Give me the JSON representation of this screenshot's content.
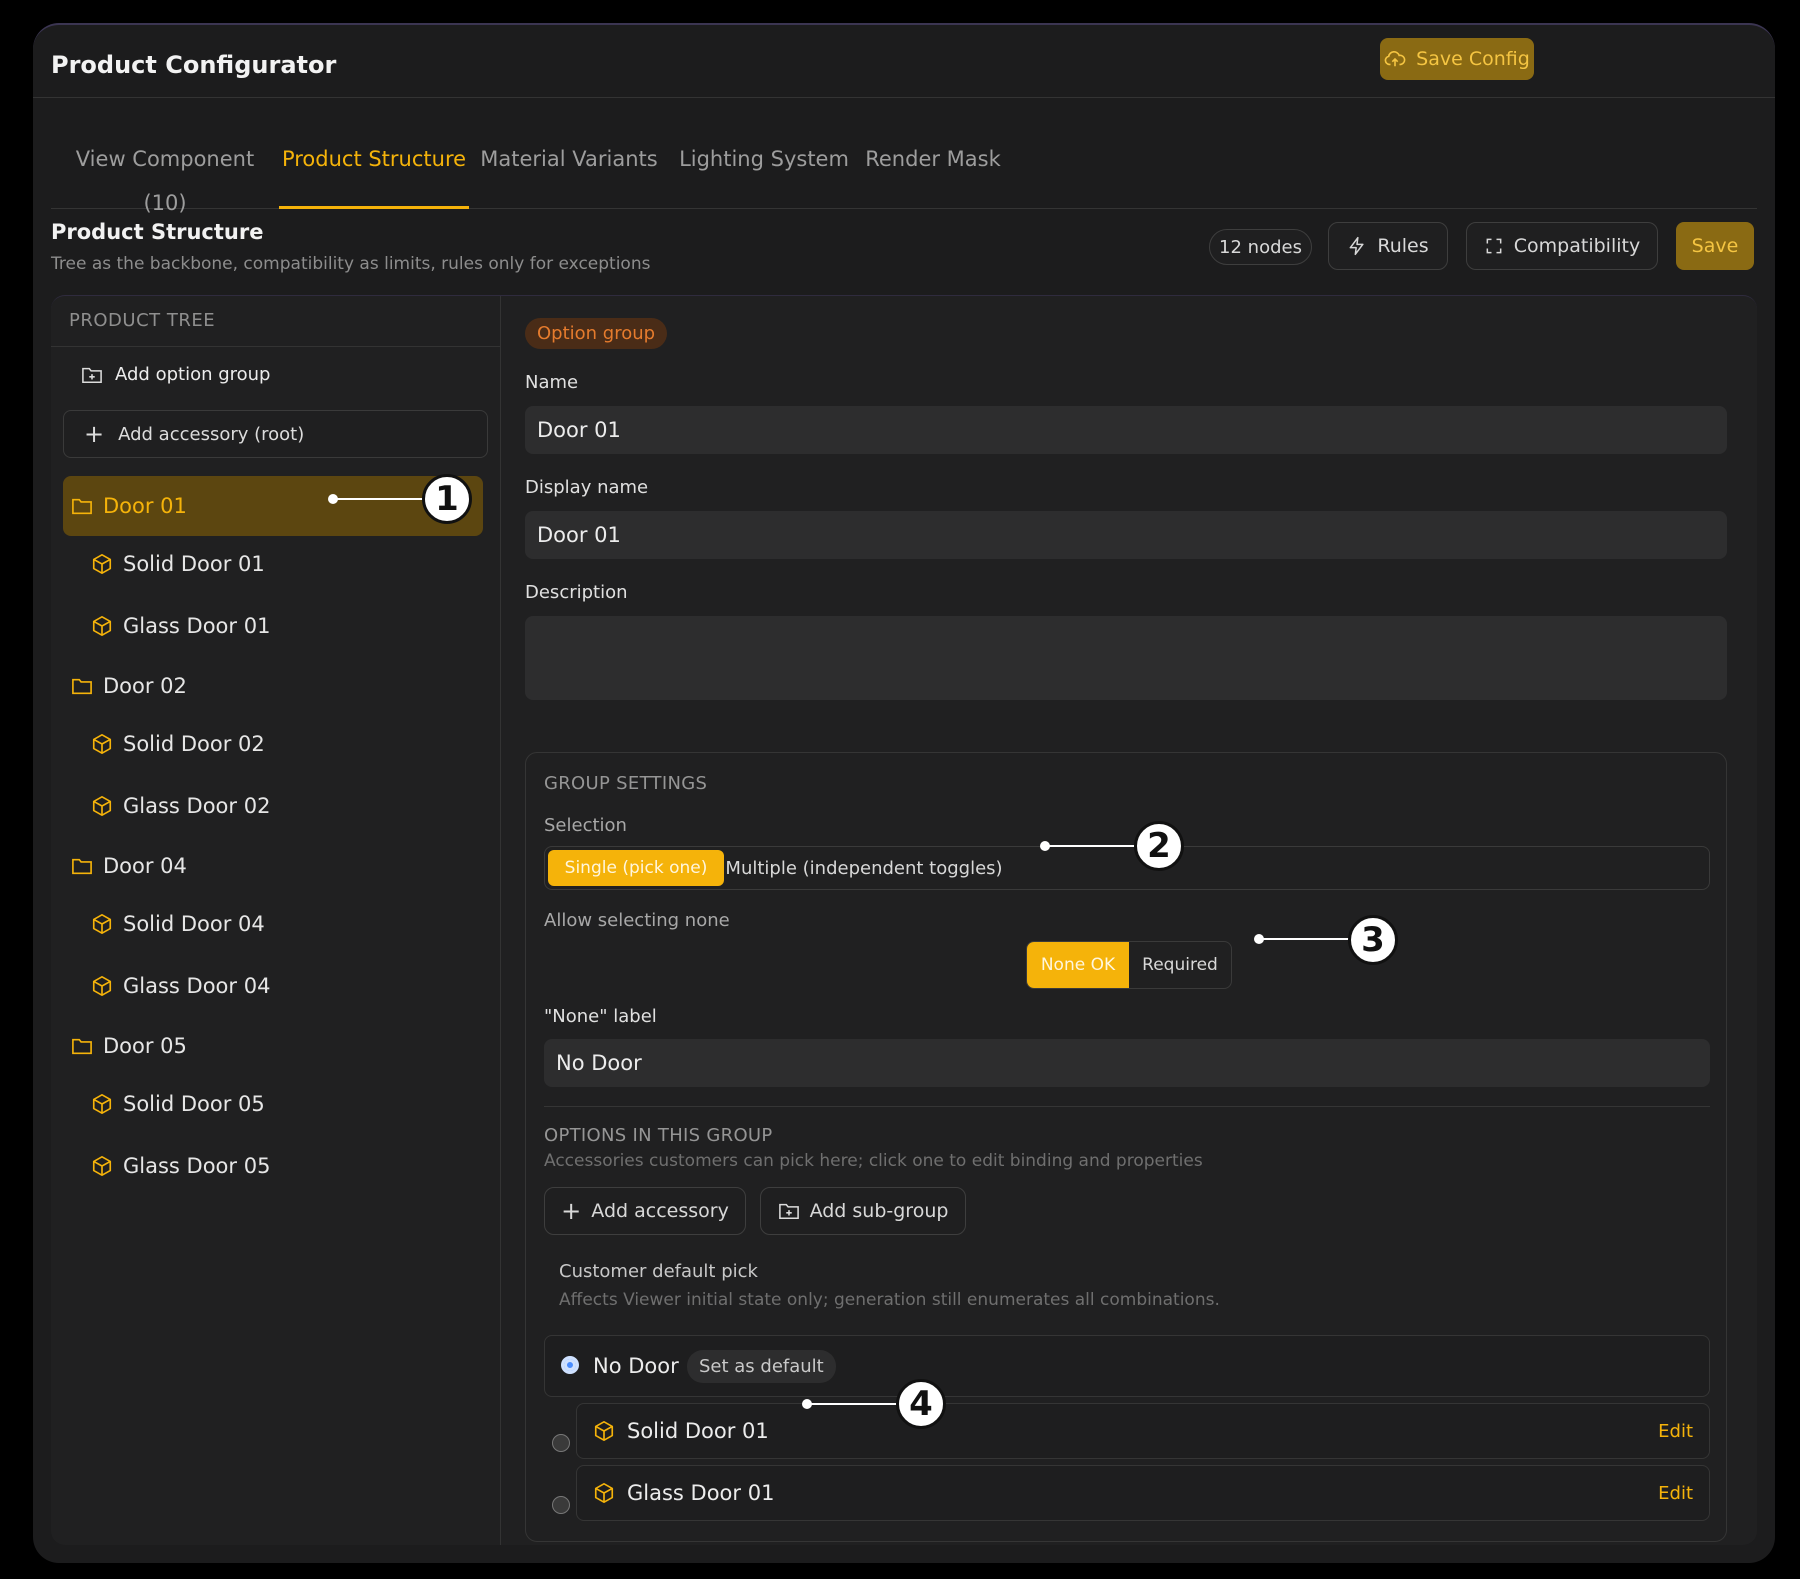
{
  "app": {
    "title": "Product Configurator",
    "save_config": "Save Config"
  },
  "tabs": [
    {
      "label": "View Component (10)"
    },
    {
      "label": "Product Structure"
    },
    {
      "label": "Material Variants"
    },
    {
      "label": "Lighting System"
    },
    {
      "label": "Render Mask"
    }
  ],
  "section": {
    "title": "Product Structure",
    "subtitle": "Tree as the backbone, compatibility as limits, rules only for exceptions",
    "nodes": "12 nodes",
    "rules": "Rules",
    "compatibility": "Compatibility",
    "save": "Save"
  },
  "tree": {
    "header": "PRODUCT TREE",
    "add_group": "Add option group",
    "add_root": "Add accessory (root)",
    "items": [
      {
        "label": "Door 01",
        "type": "group"
      },
      {
        "label": "Solid Door 01",
        "type": "child"
      },
      {
        "label": "Glass Door 01",
        "type": "child"
      },
      {
        "label": "Door 02",
        "type": "group"
      },
      {
        "label": "Solid Door 02",
        "type": "child"
      },
      {
        "label": "Glass Door 02",
        "type": "child"
      },
      {
        "label": "Door 04",
        "type": "group"
      },
      {
        "label": "Solid Door 04",
        "type": "child"
      },
      {
        "label": "Glass Door 04",
        "type": "child"
      },
      {
        "label": "Door 05",
        "type": "group"
      },
      {
        "label": "Solid Door 05",
        "type": "child"
      },
      {
        "label": "Glass Door 05",
        "type": "child"
      }
    ]
  },
  "detail": {
    "badge": "Option group",
    "name_label": "Name",
    "name_value": "Door 01",
    "display_label": "Display name",
    "display_value": "Door 01",
    "desc_label": "Description",
    "desc_value": "",
    "settings": {
      "header": "GROUP SETTINGS",
      "selection_label": "Selection",
      "single": "Single (pick one)",
      "multiple": "Multiple (independent toggles)",
      "allow_none_label": "Allow selecting none",
      "none_ok": "None OK",
      "required": "Required",
      "none_label_label": "\"None\" label",
      "none_label_value": "No Door"
    },
    "options": {
      "header": "OPTIONS IN THIS GROUP",
      "hint": "Accessories customers can pick here; click one to edit binding and properties",
      "add_accessory": "Add accessory",
      "add_subgroup": "Add sub-group",
      "default_title": "Customer default pick",
      "default_hint": "Affects Viewer initial state only; generation still enumerates all combinations.",
      "none_row": "No Door",
      "set_default": "Set as default",
      "rows": [
        {
          "label": "Solid Door 01",
          "edit": "Edit"
        },
        {
          "label": "Glass Door 01",
          "edit": "Edit"
        }
      ]
    }
  },
  "callouts": [
    "1",
    "2",
    "3",
    "4"
  ],
  "colors": {
    "accent": "#f5b30a",
    "bg": "#1c1c1d"
  }
}
